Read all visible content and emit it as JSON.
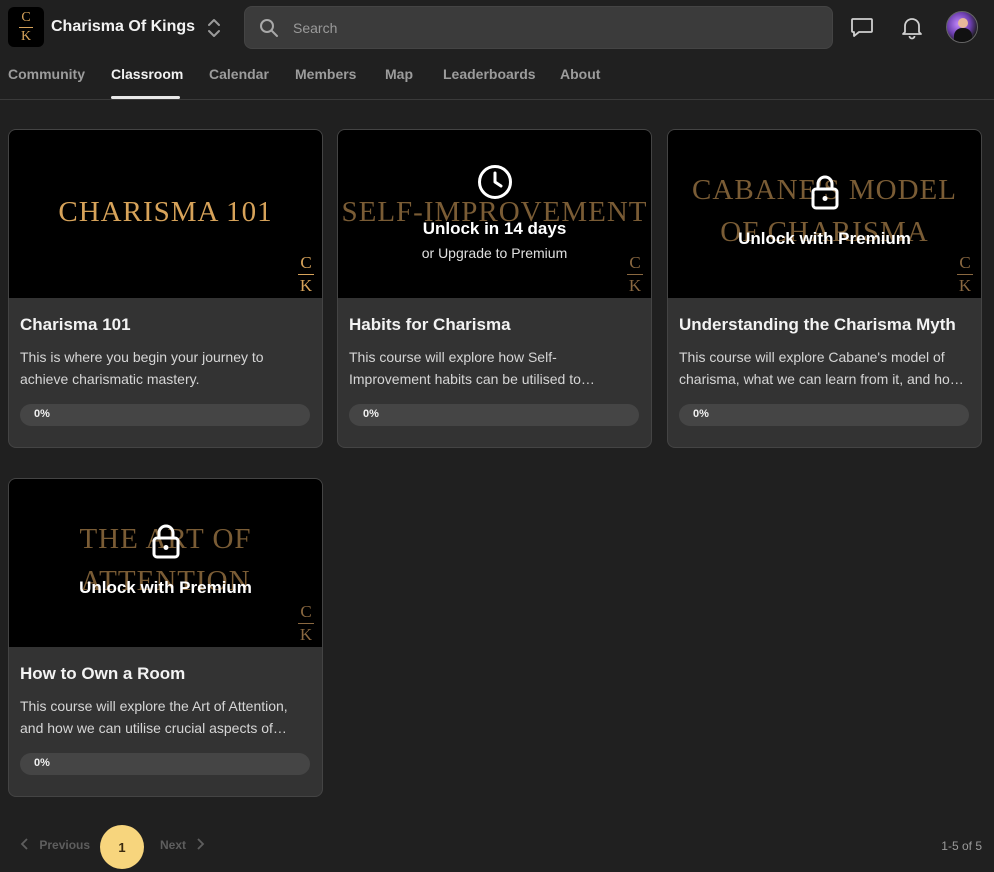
{
  "header": {
    "logo_top": "C",
    "logo_bottom": "K",
    "group_name": "Charisma Of Kings",
    "search_placeholder": "Search"
  },
  "tabs": [
    {
      "label": "Community",
      "active": false
    },
    {
      "label": "Classroom",
      "active": true
    },
    {
      "label": "Calendar",
      "active": false
    },
    {
      "label": "Members",
      "active": false
    },
    {
      "label": "Map",
      "active": false
    },
    {
      "label": "Leaderboards",
      "active": false
    },
    {
      "label": "About",
      "active": false
    }
  ],
  "courses": [
    {
      "thumb_text": "CHARISMA 101",
      "thumb_text_2": "",
      "title": "Charisma 101",
      "description": "This is where you begin your journey to achieve charismatic mastery.",
      "progress": "0%",
      "progress_value": 0,
      "locked": false,
      "overlay_title": "",
      "overlay_sub": ""
    },
    {
      "thumb_text": "SELF-IMPROVEMENT",
      "thumb_text_2": "",
      "title": "Habits for Charisma",
      "description": "This course will explore how Self-Improvement habits can be utilised to…",
      "progress": "0%",
      "progress_value": 0,
      "locked": true,
      "lock_icon": "clock-icon",
      "overlay_title": "Unlock in 14 days",
      "overlay_sub": "or Upgrade to Premium"
    },
    {
      "thumb_text": "CABANE'S MODEL",
      "thumb_text_2": "OF CHARISMA",
      "title": "Understanding the Charisma Myth",
      "description": "This course will explore Cabane's model of charisma, what we can learn from it, and ho…",
      "progress": "0%",
      "progress_value": 0,
      "locked": true,
      "lock_icon": "lock-icon",
      "overlay_title": "Unlock with Premium",
      "overlay_sub": ""
    },
    {
      "thumb_text": "THE ART OF",
      "thumb_text_2": "ATTENTION",
      "title": "How to Own a Room",
      "description": "This course will explore the Art of Attention, and how we can utilise crucial aspects of…",
      "progress": "0%",
      "progress_value": 0,
      "locked": true,
      "lock_icon": "lock-icon",
      "overlay_title": "Unlock with Premium",
      "overlay_sub": ""
    }
  ],
  "pagination": {
    "previous_label": "Previous",
    "current_page": "1",
    "next_label": "Next",
    "count_text": "1-5 of 5"
  },
  "colors": {
    "accent_gold": "#d7a35a",
    "page_badge": "#f7d57d",
    "background": "#202020",
    "card": "#333333"
  }
}
